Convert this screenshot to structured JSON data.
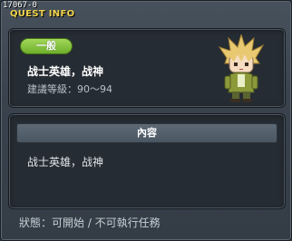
{
  "id_text": "17067-0",
  "window_title": "QUEST INFO",
  "quest": {
    "category": "一般",
    "name": "战士英雄，战神",
    "level_req": "建議等級：90～94"
  },
  "content_section": {
    "header": "內容",
    "text": "战士英雄，战神"
  },
  "status_text": "狀態：可開始 / 不可執行任務",
  "colors": {
    "title": "#f2d44a",
    "category_pill": "#8bc540",
    "panel_bg": "#262c33"
  }
}
